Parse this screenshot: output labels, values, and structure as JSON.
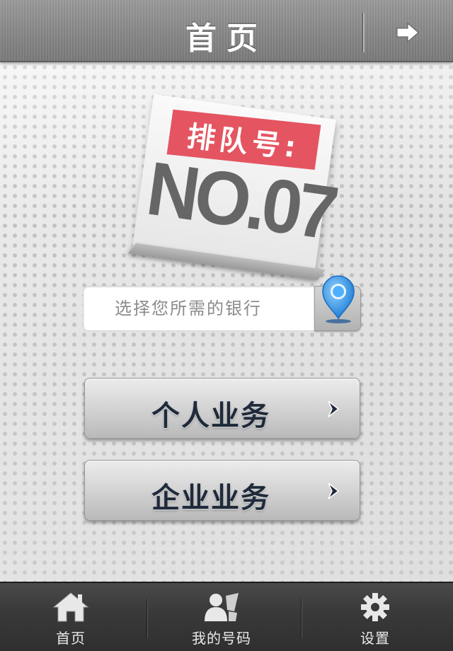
{
  "header": {
    "title": "首页",
    "next_icon": "arrow-right-icon"
  },
  "ticket": {
    "label": "排队号:",
    "number": "NO.07"
  },
  "bank_select": {
    "placeholder": "选择您所需的银行",
    "location_icon": "location-pin-icon",
    "pin_color": "#3d9be8"
  },
  "actions": [
    {
      "label": "个人业务",
      "icon": "chevron-right-icon"
    },
    {
      "label": "企业业务",
      "icon": "chevron-right-icon"
    }
  ],
  "tabbar": {
    "items": [
      {
        "label": "首页",
        "icon": "home-icon"
      },
      {
        "label": "我的号码",
        "icon": "users-icon"
      },
      {
        "label": "设置",
        "icon": "gear-icon"
      }
    ]
  },
  "colors": {
    "ticket_red": "#e45561",
    "button_text": "#1f2a3a",
    "tabbar_bg": "#3a3a3a"
  }
}
